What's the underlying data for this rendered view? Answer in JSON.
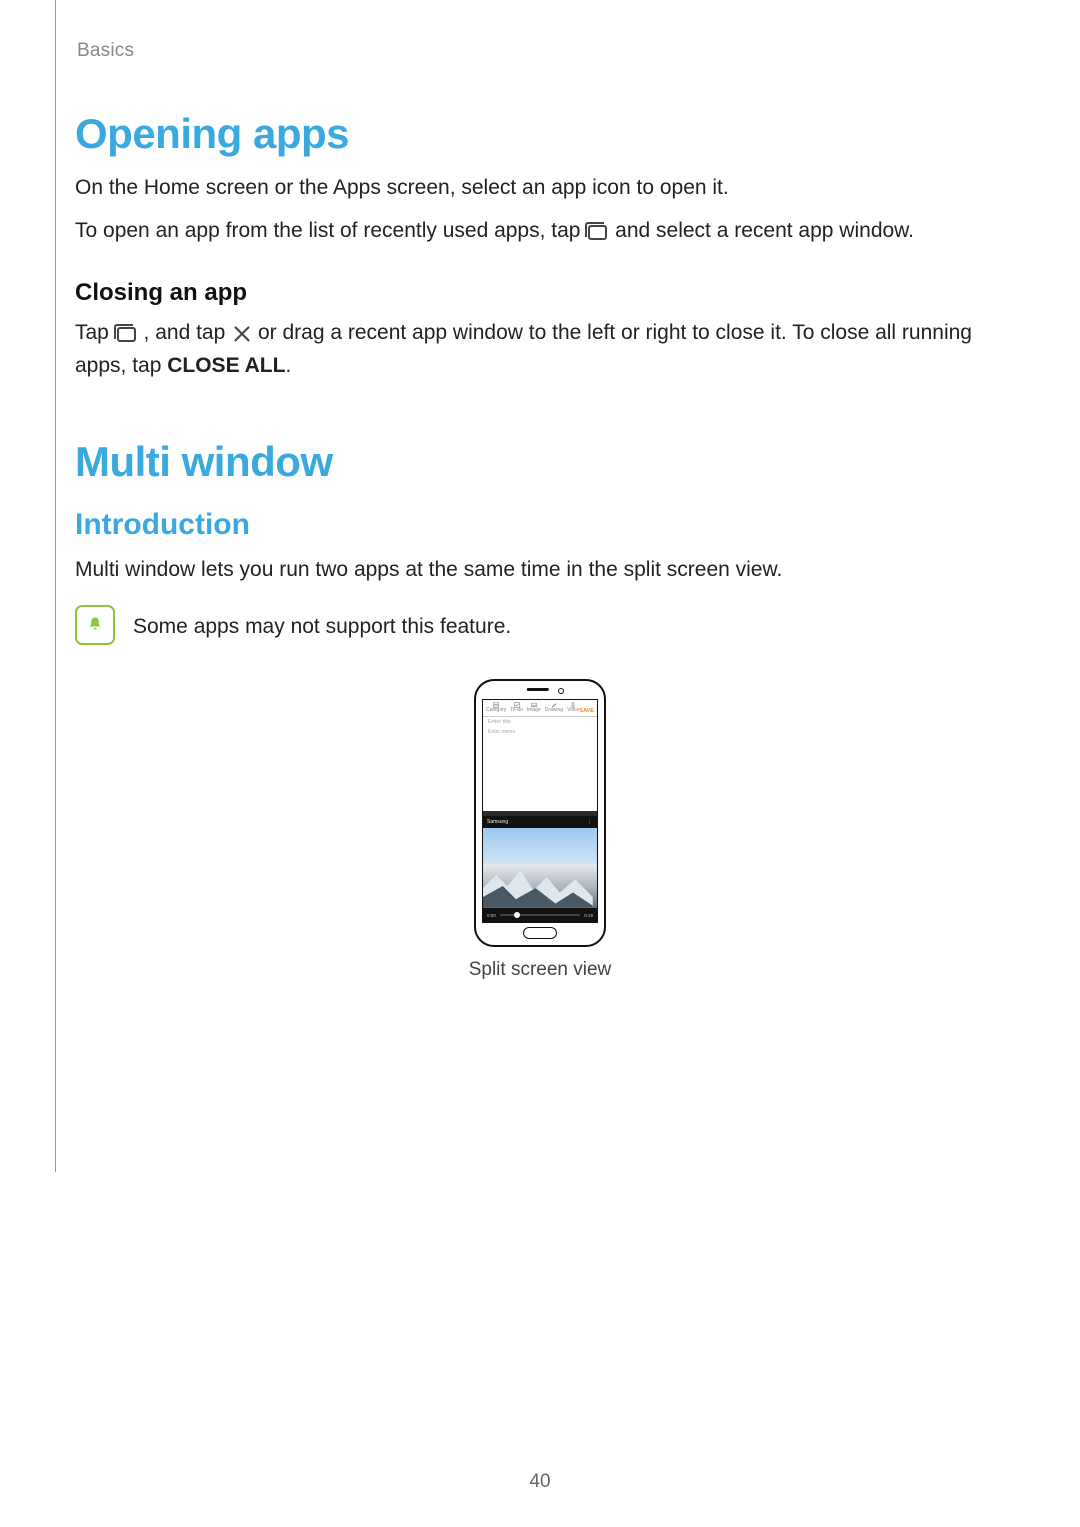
{
  "breadcrumb": "Basics",
  "h1_opening": "Opening apps",
  "opening_p1": "On the Home screen or the Apps screen, select an app icon to open it.",
  "opening_p2a": "To open an app from the list of recently used apps, tap ",
  "opening_p2b": " and select a recent app window.",
  "closing_h3": "Closing an app",
  "closing_p_a": "Tap ",
  "closing_p_b": ", and tap ",
  "closing_p_c": " or drag a recent app window to the left or right to close it. To close all running apps, tap ",
  "closing_bold": "CLOSE ALL",
  "closing_p_d": ".",
  "h1_multi": "Multi window",
  "h2_intro": "Introduction",
  "multi_p1": "Multi window lets you run two apps at the same time in the split screen view.",
  "note_text": "Some apps may not support this feature.",
  "phone": {
    "toolbar": {
      "items": [
        "Category",
        "To-do",
        "Image",
        "Drawing",
        "Voice"
      ],
      "save": "SAVE"
    },
    "title_placeholder": "Enter title",
    "memo_placeholder": "Enter memo",
    "video_title": "Samsung",
    "t_cur": "0:00",
    "t_end": "0:19"
  },
  "caption": "Split screen view",
  "page_number": "40"
}
